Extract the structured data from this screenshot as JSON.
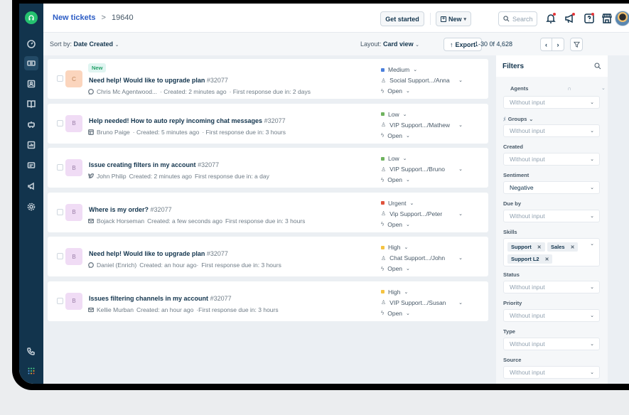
{
  "breadcrumb": {
    "parent": "New tickets",
    "separator": ">",
    "current": "19640"
  },
  "topbar": {
    "get_started": "Get started",
    "new_label": "New",
    "search_placeholder": "Search",
    "icons": [
      "bell-icon",
      "megaphone-icon",
      "help-icon",
      "store-icon"
    ]
  },
  "toolbar": {
    "sort_label": "Sort by:",
    "sort_value": "Date Created",
    "layout_label": "Layout:",
    "layout_value": "Card view",
    "export_label": "Export",
    "pagination": "1-30 0f 4,628"
  },
  "sidebar": {
    "items": [
      "dashboard",
      "tickets",
      "contacts",
      "solutions",
      "bots",
      "analytics",
      "chat",
      "campaigns",
      "settings",
      "phone",
      "apps"
    ]
  },
  "tickets": [
    {
      "new_tag": "New",
      "avatar": "C",
      "avatar_color": "orange",
      "subject": "Need help! Would like to upgrade plan",
      "number": "#32077",
      "channel_icon": "chat-icon",
      "requester": "Chris Mc Agentwood...",
      "created": "· Created: 2 minutes ago",
      "due": "· First response due in: 2 days",
      "priority": "Medium",
      "priority_color": "#4a7fdc",
      "group": "Social Support.../Anna",
      "status": "Open"
    },
    {
      "new_tag": "",
      "avatar": "B",
      "avatar_color": "purple",
      "subject": "Help needed! How to auto reply incoming chat messages",
      "number": "#32077",
      "channel_icon": "portal-icon",
      "requester": "Bruno Paige",
      "created": "· Created: 5 minutes ago",
      "due": "· First response due in: 3 hours",
      "priority": "Low",
      "priority_color": "#6fb35f",
      "group": "VIP Support.../Mathew",
      "status": "Open"
    },
    {
      "new_tag": "",
      "avatar": "B",
      "avatar_color": "purple",
      "subject": "Issue creating filters in my account",
      "number": "#32077",
      "channel_icon": "twitter-icon",
      "requester": "John Philip",
      "created": "Created: 2 minutes ago",
      "due": "First response due in: a day",
      "priority": "Low",
      "priority_color": "#6fb35f",
      "group": "VIP Support.../Bruno",
      "status": "Open"
    },
    {
      "new_tag": "",
      "avatar": "B",
      "avatar_color": "purple",
      "subject": "Where is my order?",
      "number": "#32077",
      "channel_icon": "email-icon",
      "requester": "Bojack Horseman",
      "created": "Created: a few seconds ago",
      "due": "First response due in: 3 hours",
      "priority": "Urgent",
      "priority_color": "#e0533d",
      "group": "Vip Support.../Peter",
      "status": "Open"
    },
    {
      "new_tag": "",
      "avatar": "B",
      "avatar_color": "purple",
      "subject": "Need help! Would like to upgrade plan",
      "number": "#32077",
      "channel_icon": "chat-icon",
      "requester": "Daniel (Enrich)",
      "created": "Created: an hour ago·",
      "due": "First response due in: 3 hours",
      "priority": "High",
      "priority_color": "#f5c342",
      "group": "Chat Support.../John",
      "status": "Open"
    },
    {
      "new_tag": "",
      "avatar": "B",
      "avatar_color": "purple",
      "subject": "Issues filtering channels in my account",
      "number": "#32077",
      "channel_icon": "email-icon",
      "requester": "Kellie Murban",
      "created": "Created: an hour ago",
      "due": "·First response due in: 3 hours",
      "priority": "High",
      "priority_color": "#f5c342",
      "group": "VIP Support.../Susan",
      "status": "Open"
    }
  ],
  "filters": {
    "title": "Filters",
    "agents_label": "Agents",
    "agents_value": "Without input",
    "groups_label": "Groups",
    "groups_value": "Without input",
    "created_label": "Created",
    "created_value": "Without input",
    "sentiment_label": "Sentiment",
    "sentiment_value": "Negative",
    "dueby_label": "Due by",
    "dueby_value": "Without input",
    "skills_label": "Skills",
    "skills": [
      "Support",
      "Sales",
      "Support L2"
    ],
    "status_label": "Status",
    "status_value": "Without input",
    "priority_label": "Priority",
    "priority_value": "Without input",
    "type_label": "Type",
    "type_value": "Without input",
    "source_label": "Source",
    "source_value": "Without input"
  },
  "colors": {
    "sidebar": "#12344d",
    "accent": "#2c5cc5",
    "logo": "#25c16f"
  }
}
